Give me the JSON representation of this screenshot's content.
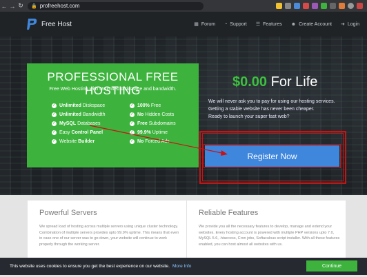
{
  "browser": {
    "url": "profreehost.com"
  },
  "header": {
    "logo_text": "Free Host",
    "menu": [
      {
        "label": "Forum",
        "icon": "comments-icon"
      },
      {
        "label": "Support",
        "icon": "support-icon"
      },
      {
        "label": "Features",
        "icon": "list-icon"
      },
      {
        "label": "Create Account",
        "icon": "user-plus-icon"
      },
      {
        "label": "Login",
        "icon": "login-icon"
      }
    ]
  },
  "hero": {
    "title": "PROFESSIONAL FREE HOSTING",
    "subtitle": "Free Web Hosting with Unlimited diskspace and bandwidth.",
    "features_left": [
      {
        "bold": "Unlimited",
        "rest": " Diskspace"
      },
      {
        "bold": "Unlimited",
        "rest": " Bandwidth"
      },
      {
        "bold": "MySQL",
        "rest": " Databases"
      },
      {
        "bold": "Control Panel",
        "pre": "Easy ",
        "rest": ""
      },
      {
        "bold": "Builder",
        "pre": "Website ",
        "rest": ""
      }
    ],
    "features_right": [
      {
        "bold": "100%",
        "rest": " Free"
      },
      {
        "bold": "No",
        "rest": " Hidden Costs"
      },
      {
        "bold": "Free",
        "rest": " Subdomains"
      },
      {
        "bold": "99.9%",
        "rest": " Uptime"
      },
      {
        "bold": "No",
        "rest": " Forced Ads"
      }
    ],
    "price_amount": "$0.00",
    "price_suffix": " For Life",
    "desc_lines": [
      "We will never ask you to pay for using our hosting services.",
      "Getting a stable website has never been cheaper.",
      "Ready to launch your super fast web?"
    ],
    "register_label": "Register Now"
  },
  "cards": [
    {
      "title": "Powerful Servers",
      "text": "We spread load of hosting across multiple servers using unique cluster technology. Combination of multiple servers provides upto 99.9% uptime. This means that even in case one of our server was to go down, your website will continue to work properly through the working server."
    },
    {
      "title": "Reliable Features",
      "text": "We provide you all the necessary features to develop, manage and extend your websites. Every hosting account is powered with multiple PHP versions upto 7.0, MySQL 5.6, .htaccess, Cron jobs, Softaculous script installer. With all these features enabled, you can host almost all websites with us."
    }
  ],
  "cookie": {
    "text": "This website uses cookies to ensure you get the best experience on our website.",
    "link": "More Info",
    "button": "Continue"
  },
  "colors": {
    "brand_green": "#3db33e",
    "register_blue": "#3f86dd",
    "annotation_red": "#cc1111"
  }
}
